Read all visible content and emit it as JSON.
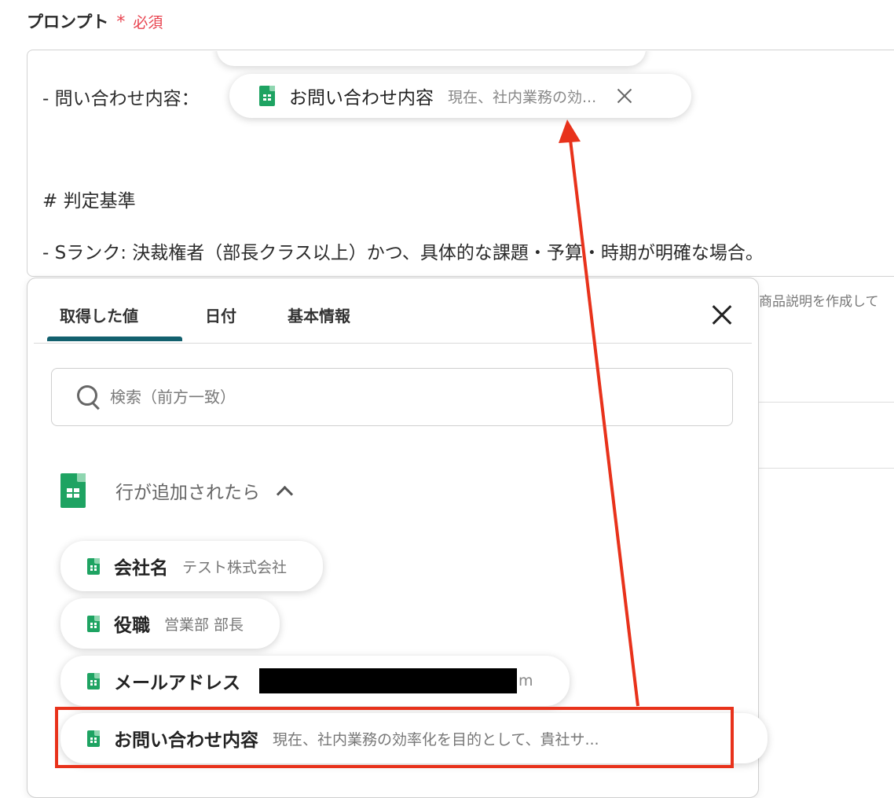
{
  "field": {
    "label": "プロンプト",
    "required_mark": "*",
    "required_text": "必須"
  },
  "prompt": {
    "line_inquiry_prefix": "- 問い合わせ内容：",
    "line_criteria_heading": "# 判定基準",
    "line_s_rank": "- Sランク: 決裁権者（部長クラス以上）かつ、具体的な課題・予算・時期が明確な場合。",
    "inserted_chip": {
      "name": "お問い合わせ内容",
      "value": "現在、社内業務の効..."
    }
  },
  "background": {
    "partial_text": "商品説明を作成して"
  },
  "panel": {
    "tabs": [
      {
        "label": "取得した値"
      },
      {
        "label": "日付"
      },
      {
        "label": "基本情報"
      }
    ],
    "search": {
      "placeholder": "検索（前方一致）"
    },
    "group": {
      "title": "行が追加されたら"
    },
    "items": [
      {
        "name": "会社名",
        "value": "テスト株式会社"
      },
      {
        "name": "役職",
        "value": "営業部 部長"
      },
      {
        "name": "メールアドレス",
        "value_tail": "m"
      },
      {
        "name": "お問い合わせ内容",
        "value": "現在、社内業務の効率化を目的として、貴社サ..."
      }
    ]
  },
  "annotation": {
    "color": "#e8321b"
  }
}
